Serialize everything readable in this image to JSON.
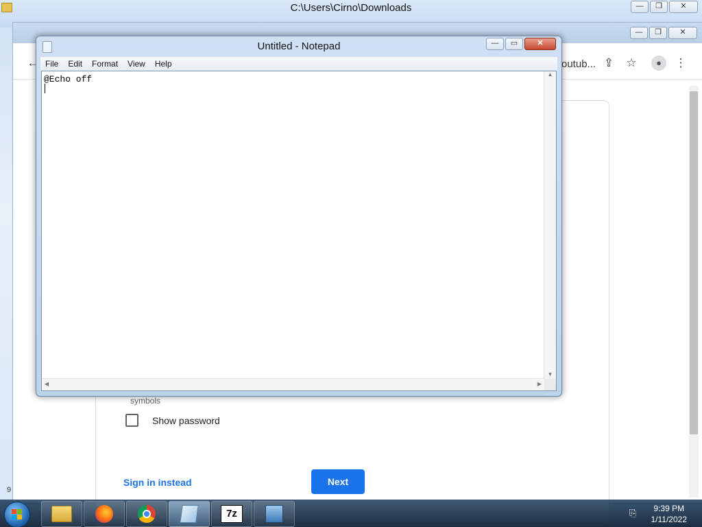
{
  "explorer": {
    "title": "C:\\Users\\Cirno\\Downloads",
    "min": "—",
    "max": "❐",
    "close": "✕"
  },
  "chrome": {
    "omnibox_partial": "outub...",
    "min": "—",
    "max": "❐",
    "close": "✕",
    "icons": {
      "back": "arrow-left-icon",
      "share": "share-icon",
      "bookmark": "star-icon",
      "profile": "account-icon",
      "menu": "more-vert-icon"
    },
    "form": {
      "hint": "symbols",
      "show_password_label": "Show password",
      "sign_in_label": "Sign in instead",
      "next_label": "Next"
    },
    "left_digit": "9"
  },
  "notepad": {
    "title": "Untitled - Notepad",
    "menu": [
      "File",
      "Edit",
      "Format",
      "View",
      "Help"
    ],
    "content": "@Echo off",
    "min": "—",
    "max": "▭",
    "close": "✕"
  },
  "taskbar": {
    "apps": [
      {
        "name": "explorer",
        "icon": "folder-icon"
      },
      {
        "name": "firefox",
        "icon": "firefox-icon"
      },
      {
        "name": "chrome",
        "icon": "chrome-icon"
      },
      {
        "name": "notepad",
        "icon": "notepad-icon",
        "active": true
      },
      {
        "name": "7zip",
        "icon": "7zip-icon",
        "label": "7z"
      },
      {
        "name": "installer",
        "icon": "installer-icon"
      }
    ],
    "clock": {
      "time": "9:39 PM",
      "date": "1/11/2022"
    }
  }
}
